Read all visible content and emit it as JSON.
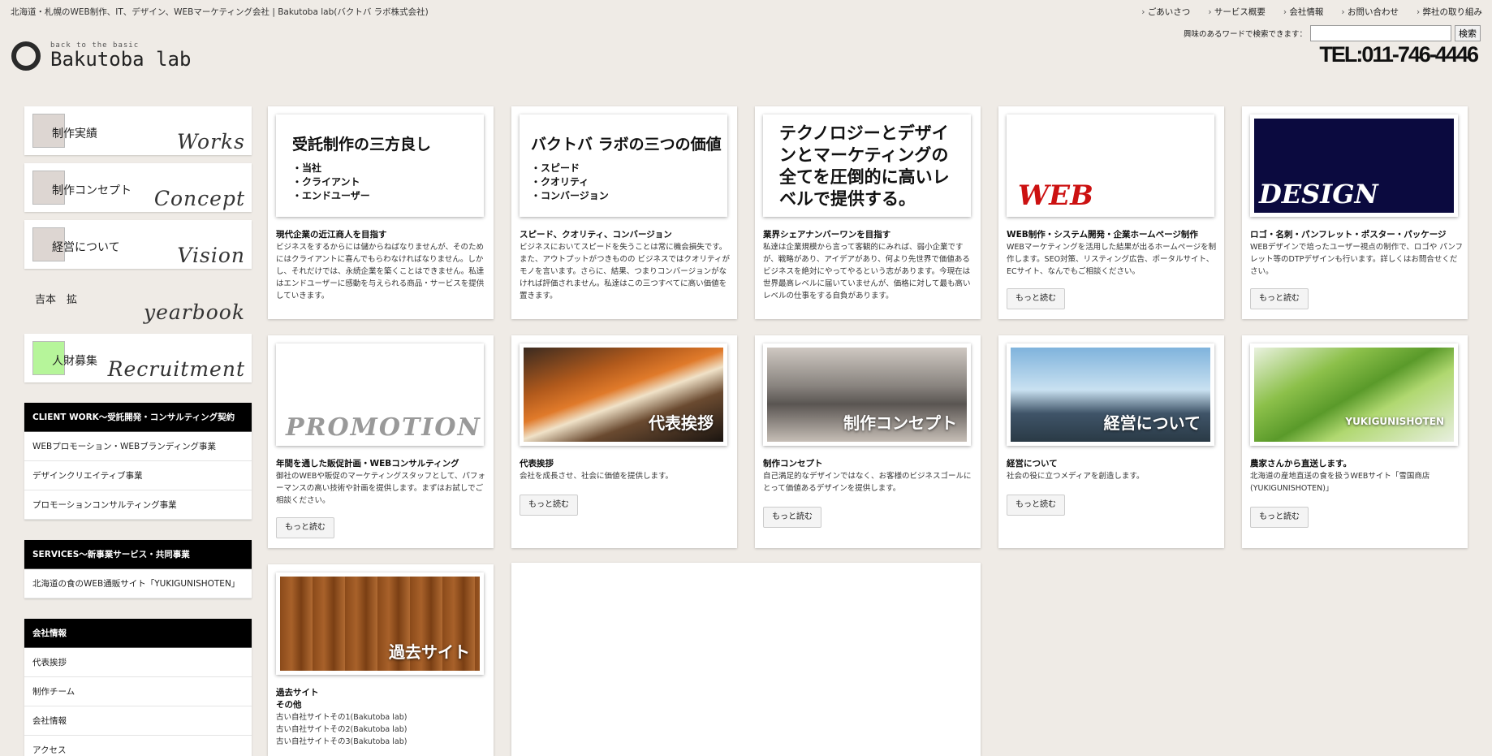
{
  "header": {
    "site_desc": "北海道・札幌のWEB制作、IT、デザイン、WEBマーケティング会社 | Bakutoba lab(バクトバ ラボ株式会社)",
    "nav": [
      "ごあいさつ",
      "サービス概要",
      "会社情報",
      "お問い合わせ",
      "弊社の取り組み"
    ],
    "logo_tag": "back to the basic",
    "logo_name": "Bakutoba lab",
    "search_label": "興味のあるワードで検索できます：",
    "search_button": "検索",
    "tel": "TEL:011-746-4446"
  },
  "sidebar": {
    "menu": [
      {
        "jp": "制作実績",
        "en": "Works"
      },
      {
        "jp": "制作コンセプト",
        "en": "Concept"
      },
      {
        "jp": "経営について",
        "en": "Vision"
      },
      {
        "jp": "吉本　拡",
        "en": "yearbook"
      },
      {
        "jp": "人財募集",
        "en": "Recruitment"
      }
    ],
    "blocks": [
      {
        "head": "CLIENT WORK～受託開発・コンサルティング契約",
        "links": [
          "WEBプロモーション・WEBブランディング事業",
          "デザインクリエイティブ事業",
          "プロモーションコンサルティング事業"
        ]
      },
      {
        "head": "SERVICES～新事業サービス・共同事業",
        "links": [
          "北海道の食のWEB通販サイト「YUKIGUNISHOTEN」"
        ]
      },
      {
        "head": "会社情報",
        "links": [
          "代表挨拶",
          "制作チーム",
          "会社情報",
          "アクセス"
        ]
      }
    ]
  },
  "cards": {
    "c1": {
      "img_title": "受託制作の三方良し",
      "img_list": [
        "・当社",
        "・クライアント",
        "・エンドユーザー"
      ],
      "title": "現代企業の近江商人を目指す",
      "desc": "ビジネスをするからには儲からねばなりませんが、そのためにはクライアントに喜んでもらわなければなりません。しかし、それだけでは、永続企業を築くことはできません。私達はエンドユーザーに感動を与えられる商品・サービスを提供していきます。"
    },
    "c2": {
      "img_title": "バクトバ ラボの三つの価値",
      "img_list": [
        "・スピード",
        "・クオリティ",
        "・コンバージョン"
      ],
      "title": "スピード、クオリティ、コンバージョン",
      "desc": "ビジネスにおいてスピードを失うことは常に機会損失です。また、アウトプットがつきものの ビジネスではクオリティがモノを言います。さらに、結果、つまりコンバージョンがなければ評価されません。私達はこの三つすべてに高い価値を置きます。"
    },
    "c3": {
      "img_title": "テクノロジーとデザインとマーケティングの全てを圧倒的に高いレベルで提供する。",
      "title": "業界シェアナンバーワンを目指す",
      "desc": "私達は企業規模から言って客観的にみれば、弱小企業ですが、戦略があり、アイデアがあり、何より先世界で価値あるビジネスを絶対にやってやるという志があります。今現在は世界最高レベルに届いていませんが、価格に対して最も高いレベルの仕事をする自負があります。"
    },
    "c4": {
      "img_word": "WEB",
      "title": "WEB制作・システム開発・企業ホームページ制作",
      "desc": "WEBマーケティングを活用した結果が出るホームページを制作します。SEO対策、リスティング広告、ポータルサイト、ECサイト、なんでもご相談ください。",
      "more": "もっと読む"
    },
    "c5": {
      "img_word": "DESIGN",
      "title": "ロゴ・名刺・パンフレット・ポスター・パッケージ",
      "desc": "WEBデザインで培ったユーザー視点の制作で、ロゴや パンフレット等のDTPデザインも行います。詳しくはお問合せください。",
      "more": "もっと読む"
    },
    "c6": {
      "img_word": "PROMOTION",
      "title": "年間を通した販促計画・WEBコンサルティング",
      "desc": "御社のWEBや販促のマーケティングスタッフとして、パフォーマンスの高い技術や計画を提供します。まずはお試しでご相談ください。",
      "more": "もっと読む"
    },
    "c7": {
      "img_label": "代表挨拶",
      "title": "代表挨拶",
      "desc": "会社を成長させ、社会に価値を提供します。",
      "more": "もっと読む"
    },
    "c8": {
      "img_label": "制作コンセプト",
      "title": "制作コンセプト",
      "desc": "自己満足的なデザインではなく、お客様のビジネスゴールにとって価値あるデザインを提供します。",
      "more": "もっと読む"
    },
    "c9": {
      "img_label": "経営について",
      "title": "経営について",
      "desc": "社会の役に立つメディアを創造します。",
      "more": "もっと読む"
    },
    "c10": {
      "img_label": "YUKIGUNISHOTEN",
      "title": "農家さんから直送します。",
      "desc": "北海道の産地直送の食を扱うWEBサイト「雪国商店(YUKIGUNISHOTEN)」",
      "more": "もっと読む"
    },
    "c11": {
      "img_label": "過去サイト",
      "title": "過去サイト",
      "sub": "その他",
      "links": [
        "古い自社サイトその1(Bakutoba lab)",
        "古い自社サイトその2(Bakutoba lab)",
        "古い自社サイトその3(Bakutoba lab)"
      ]
    }
  },
  "colors": {
    "background": "#efebe6",
    "dark_block": "#000000",
    "design_navy": "#0b0a3f",
    "web_red": "#cc1111"
  }
}
